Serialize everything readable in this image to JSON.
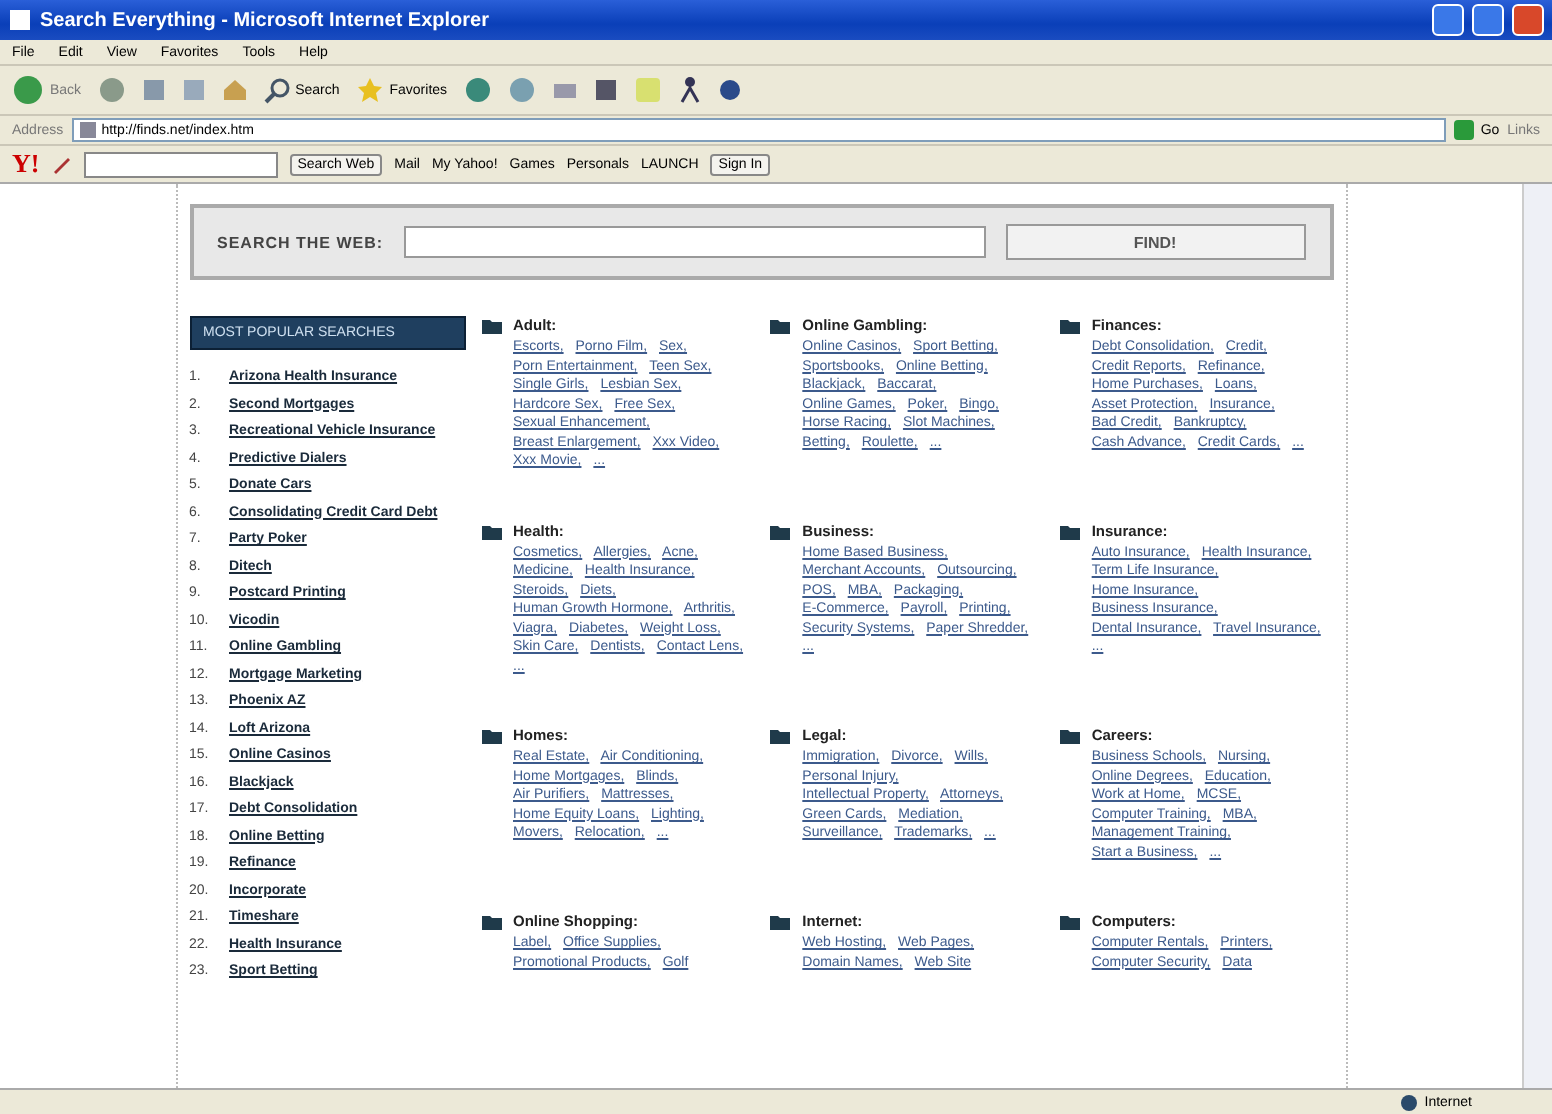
{
  "window": {
    "title": "Search Everything - Microsoft Internet Explorer"
  },
  "menu": [
    "File",
    "Edit",
    "View",
    "Favorites",
    "Tools",
    "Help"
  ],
  "toolbar": {
    "back": "Back",
    "search": "Search",
    "favorites": "Favorites"
  },
  "address": {
    "label": "Address",
    "value": "http://finds.net/index.htm",
    "go": "Go",
    "links": "Links"
  },
  "yahoo_toolbar": {
    "logo": "Y!",
    "search_button": "Search Web",
    "items": [
      "Mail",
      "My Yahoo!",
      "Games",
      "Personals",
      "LAUNCH"
    ],
    "sign_in": "Sign In"
  },
  "search": {
    "label": "SEARCH THE WEB:",
    "button": "FIND!"
  },
  "popular": {
    "title": "MOST POPULAR SEARCHES",
    "items": [
      {
        "num": "1.",
        "text": "Arizona Health Insurance"
      },
      {
        "num": "2.",
        "text": "Second Mortgages"
      },
      {
        "num": "3.",
        "text": "Recreational Vehicle Insurance"
      },
      {
        "num": "4.",
        "text": "Predictive Dialers"
      },
      {
        "num": "5.",
        "text": "Donate Cars"
      },
      {
        "num": "6.",
        "text": "Consolidating Credit Card Debt"
      },
      {
        "num": "7.",
        "text": "Party Poker"
      },
      {
        "num": "8.",
        "text": "Ditech"
      },
      {
        "num": "9.",
        "text": "Postcard Printing"
      },
      {
        "num": "10.",
        "text": "Vicodin"
      },
      {
        "num": "11.",
        "text": "Online Gambling"
      },
      {
        "num": "12.",
        "text": "Mortgage Marketing"
      },
      {
        "num": "13.",
        "text": "Phoenix AZ"
      },
      {
        "num": "14.",
        "text": "Loft Arizona"
      },
      {
        "num": "15.",
        "text": "Online Casinos"
      },
      {
        "num": "16.",
        "text": "Blackjack"
      },
      {
        "num": "17.",
        "text": "Debt Consolidation"
      },
      {
        "num": "18.",
        "text": "Online Betting"
      },
      {
        "num": "19.",
        "text": "Refinance"
      },
      {
        "num": "20.",
        "text": "Incorporate"
      },
      {
        "num": "21.",
        "text": "Timeshare"
      },
      {
        "num": "22.",
        "text": "Health Insurance"
      },
      {
        "num": "23.",
        "text": "Sport Betting"
      }
    ]
  },
  "categories": [
    {
      "title": "Adult:",
      "links": [
        "Escorts,",
        "Porno Film,",
        "Sex,",
        "Porn Entertainment,",
        "Teen Sex,",
        "Single Girls,",
        "Lesbian Sex,",
        "Hardcore Sex,",
        "Free Sex,",
        "Sexual Enhancement,",
        "Breast Enlargement,",
        "Xxx Video,",
        "Xxx Movie,",
        "..."
      ]
    },
    {
      "title": "Online Gambling:",
      "links": [
        "Online Casinos,",
        "Sport Betting,",
        "Sportsbooks,",
        "Online Betting,",
        "Blackjack,",
        "Baccarat,",
        "Online Games,",
        "Poker,",
        "Bingo,",
        "Horse Racing,",
        "Slot Machines,",
        "Betting,",
        "Roulette,",
        "..."
      ]
    },
    {
      "title": "Finances:",
      "links": [
        "Debt Consolidation,",
        "Credit,",
        "Credit Reports,",
        "Refinance,",
        "Home Purchases,",
        "Loans,",
        "Asset Protection,",
        "Insurance,",
        "Bad Credit,",
        "Bankruptcy,",
        "Cash Advance,",
        "Credit Cards,",
        "..."
      ]
    },
    {
      "title": "Health:",
      "links": [
        "Cosmetics,",
        "Allergies,",
        "Acne,",
        "Medicine,",
        "Health Insurance,",
        "Steroids,",
        "Diets,",
        "Human Growth Hormone,",
        "Arthritis,",
        "Viagra,",
        "Diabetes,",
        "Weight Loss,",
        "Skin Care,",
        "Dentists,",
        "Contact Lens,",
        "..."
      ]
    },
    {
      "title": "Business:",
      "links": [
        "Home Based Business,",
        "Merchant Accounts,",
        "Outsourcing,",
        "POS,",
        "MBA,",
        "Packaging,",
        "E-Commerce,",
        "Payroll,",
        "Printing,",
        "Security Systems,",
        "Paper Shredder,",
        "..."
      ]
    },
    {
      "title": "Insurance:",
      "links": [
        "Auto Insurance,",
        "Health Insurance,",
        "Term Life Insurance,",
        "Home Insurance,",
        "Business Insurance,",
        "Dental Insurance,",
        "Travel Insurance,",
        "..."
      ]
    },
    {
      "title": "Homes:",
      "links": [
        "Real Estate,",
        "Air Conditioning,",
        "Home Mortgages,",
        "Blinds,",
        "Air Purifiers,",
        "Mattresses,",
        "Home Equity Loans,",
        "Lighting,",
        "Movers,",
        "Relocation,",
        "..."
      ]
    },
    {
      "title": "Legal:",
      "links": [
        "Immigration,",
        "Divorce,",
        "Wills,",
        "Personal Injury,",
        "Intellectual Property,",
        "Attorneys,",
        "Green Cards,",
        "Mediation,",
        "Surveillance,",
        "Trademarks,",
        "..."
      ]
    },
    {
      "title": "Careers:",
      "links": [
        "Business Schools,",
        "Nursing,",
        "Online Degrees,",
        "Education,",
        "Work at Home,",
        "MCSE,",
        "Computer Training,",
        "MBA,",
        "Management Training,",
        "Start a Business,",
        "..."
      ]
    },
    {
      "title": "Online Shopping:",
      "links": [
        "Label,",
        "Office Supplies,",
        "Promotional Products,",
        "Golf"
      ]
    },
    {
      "title": "Internet:",
      "links": [
        "Web Hosting,",
        "Web Pages,",
        "Domain Names,",
        "Web Site"
      ]
    },
    {
      "title": "Computers:",
      "links": [
        "Computer Rentals,",
        "Printers,",
        "Computer Security,",
        "Data"
      ]
    }
  ],
  "status_bar": {
    "zone": "Internet"
  }
}
